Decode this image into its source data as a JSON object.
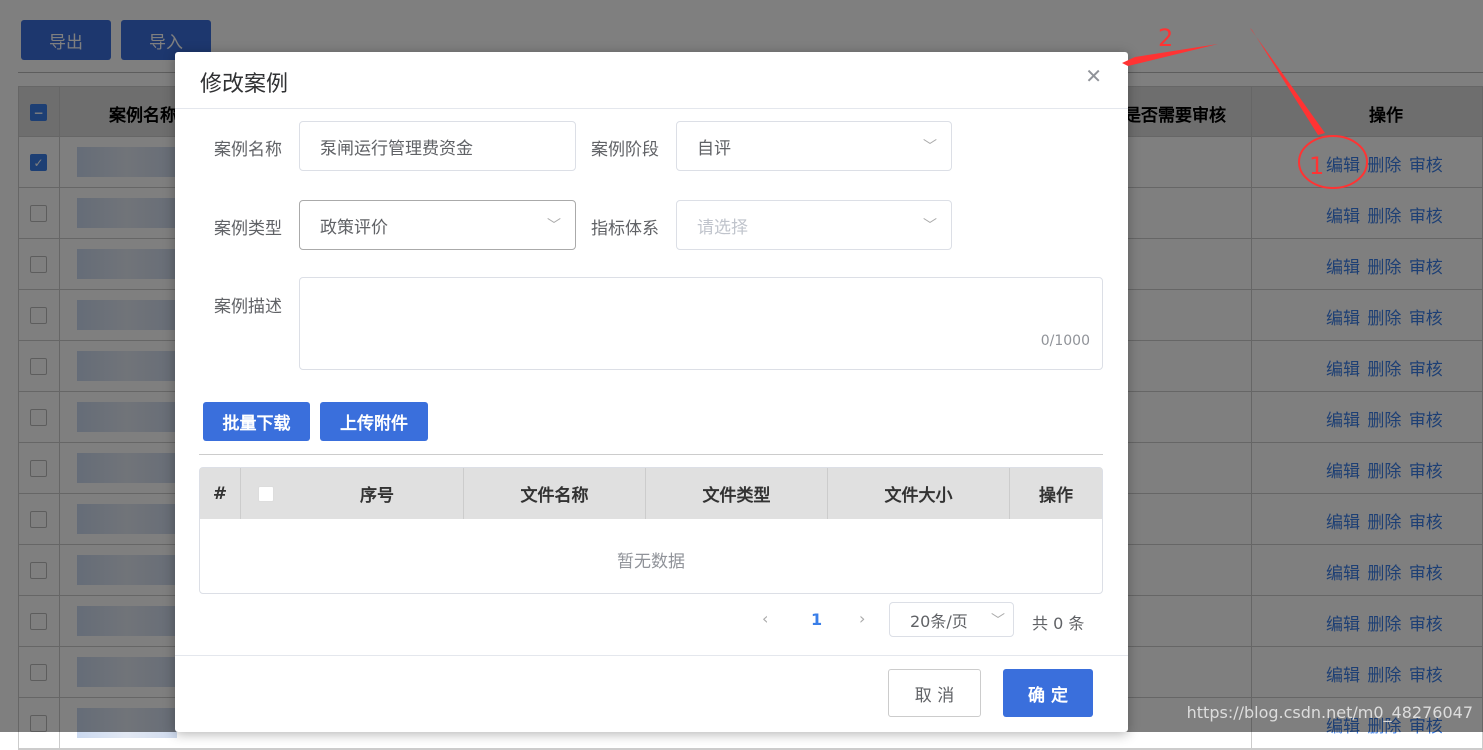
{
  "toolbar": {
    "export": "导出",
    "import": "导入"
  },
  "table": {
    "col_name": "案例名称",
    "col_review": "是否需要审核",
    "col_ops": "操作",
    "row_ops": [
      "编辑",
      "删除",
      "审核"
    ],
    "row_count": 12
  },
  "modal": {
    "title": "修改案例",
    "close_icon": "close-icon",
    "fields": {
      "name_label": "案例名称",
      "name_value": "泵闸运行管理费资金",
      "stage_label": "案例阶段",
      "stage_value": "自评",
      "type_label": "案例类型",
      "type_value": "政策评价",
      "index_label": "指标体系",
      "index_placeholder": "请选择",
      "desc_label": "案例描述",
      "desc_count": "0/1000"
    },
    "buttons": {
      "download": "批量下载",
      "upload": "上传附件",
      "cancel": "取 消",
      "confirm": "确 定"
    },
    "files": {
      "columns": [
        "#",
        "",
        "序号",
        "文件名称",
        "文件类型",
        "文件大小",
        "操作"
      ],
      "empty": "暂无数据"
    },
    "pagination": {
      "page": "1",
      "page_size": "20条/页",
      "total": "共 0 条"
    }
  },
  "annotations": {
    "one": "1",
    "two": "2"
  },
  "watermark": "https://blog.csdn.net/m0_48276047",
  "colors": {
    "primary": "#3a6fdc",
    "annotation": "#ff3333"
  }
}
